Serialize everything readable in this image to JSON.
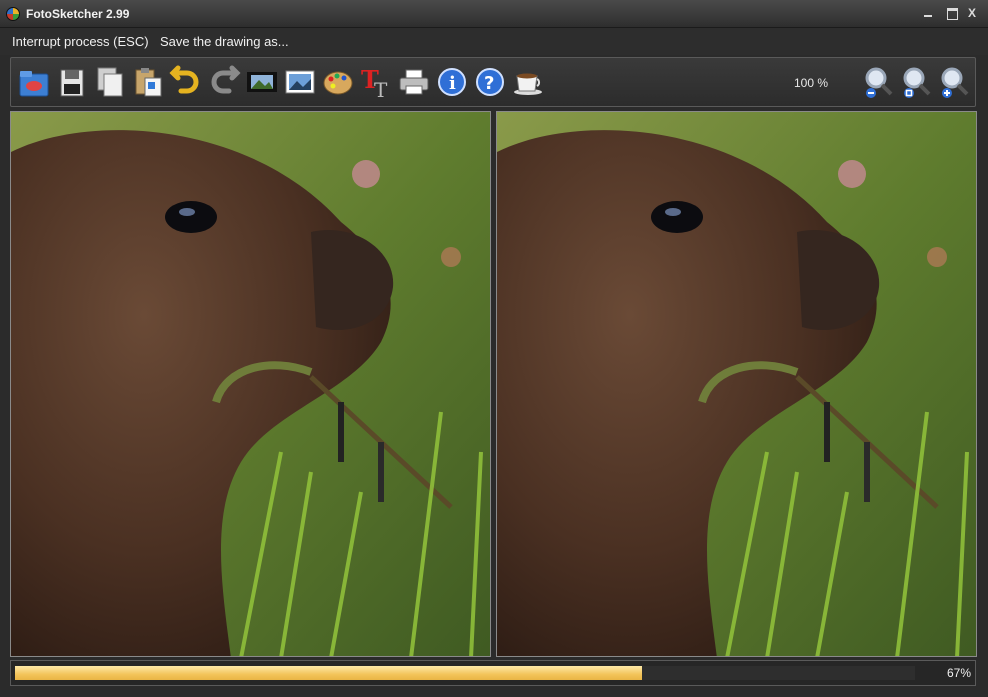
{
  "window": {
    "title": "FotoSketcher 2.99"
  },
  "menu": {
    "items": [
      "Interrupt process (ESC)",
      "Save the drawing as..."
    ]
  },
  "toolbar": {
    "buttons": [
      "open-folder-icon",
      "save-disk-icon",
      "copy-icon",
      "paste-icon",
      "undo-icon",
      "redo-icon",
      "film-strip-icon",
      "picture-icon",
      "palette-icon",
      "text-icon",
      "printer-icon",
      "info-icon",
      "help-icon",
      "coffee-cup-icon"
    ],
    "zoom_level": "100 %",
    "zoom_buttons": [
      "zoom-out-icon",
      "zoom-fit-icon",
      "zoom-in-icon"
    ]
  },
  "progress": {
    "value": 0.67,
    "label": "67%"
  },
  "colors": {
    "accent": "#f3c45a",
    "background": "#2b2b2b",
    "panel_border": "#5a5a5a"
  }
}
